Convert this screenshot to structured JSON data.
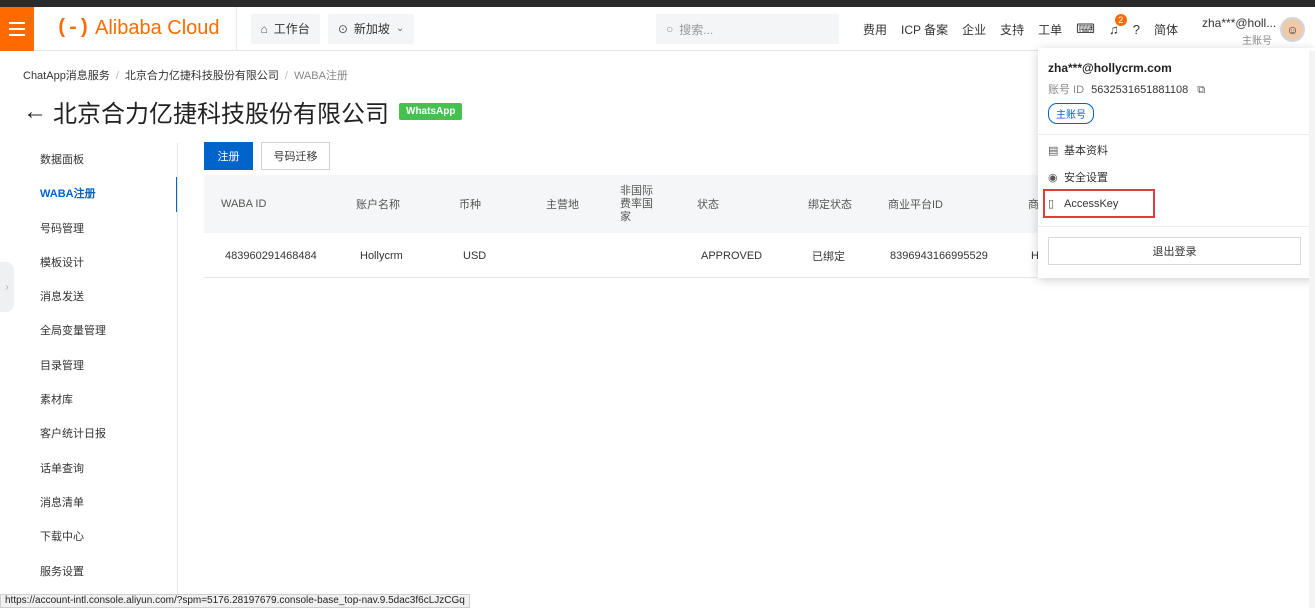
{
  "header": {
    "logo_text": "Alibaba Cloud",
    "logo_mark": "(-)",
    "workbench_label": "工作台",
    "region_label": "新加坡",
    "search_placeholder": "搜索...",
    "nav_items": [
      "费用",
      "ICP 备案",
      "企业",
      "支持",
      "工单"
    ],
    "notification_count": "2",
    "language_label": "简体",
    "account_name": "zha***@holl...",
    "account_sub": "主账号",
    "brand_color": "#ff6a00"
  },
  "breadcrumb": {
    "items": [
      "ChatApp消息服务",
      "北京合力亿捷科技股份有限公司",
      "WABA注册"
    ]
  },
  "page": {
    "back_icon": "arrow-left-icon",
    "title": "北京合力亿捷科技股份有限公司",
    "badge": "WhatsApp"
  },
  "sidebar": {
    "items": [
      {
        "label": "数据面板"
      },
      {
        "label": "WABA注册"
      },
      {
        "label": "号码管理"
      },
      {
        "label": "模板设计"
      },
      {
        "label": "消息发送"
      },
      {
        "label": "全局变量管理"
      },
      {
        "label": "目录管理"
      },
      {
        "label": "素材库"
      },
      {
        "label": "客户统计日报"
      },
      {
        "label": "话单查询"
      },
      {
        "label": "消息清单"
      },
      {
        "label": "下载中心"
      },
      {
        "label": "服务设置"
      }
    ],
    "active_index": 1
  },
  "toolbar": {
    "register_label": "注册",
    "migrate_label": "号码迁移"
  },
  "table": {
    "columns": [
      "WABA ID",
      "账户名称",
      "币种",
      "主营地",
      "非国际费率国家",
      "状态",
      "绑定状态",
      "商业平台ID",
      "商"
    ],
    "rows": [
      {
        "waba_id": "483960291468484",
        "account_name": "Hollycrm",
        "currency": "USD",
        "main_location": "",
        "non_intl_country": "",
        "status": "APPROVED",
        "bind_status": "已绑定",
        "business_id": "8396943166995529",
        "trailing": "H"
      }
    ]
  },
  "dropdown": {
    "email": "zha***@hollycrm.com",
    "account_id_label": "账号 ID",
    "account_id": "5632531651881108",
    "account_tag": "主账号",
    "items": [
      "基本资料",
      "安全设置",
      "AccessKey"
    ],
    "logout_label": "退出登录"
  },
  "status_bar": {
    "url": "https://account-intl.console.aliyun.com/?spm=5176.28197679.console-base_top-nav.9.5dac3f6cLJzCGq"
  }
}
